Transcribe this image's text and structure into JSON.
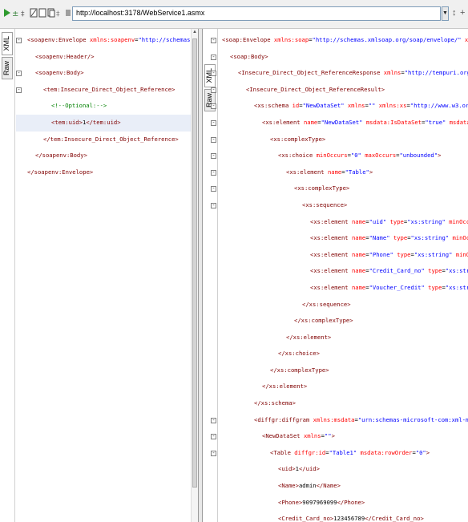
{
  "toolbar": {
    "url": "http://localhost:3178/WebService1.asmx",
    "dropdown_glyph": "▼",
    "icons": [
      "run-icon",
      "add-header-icon",
      "format-icon",
      "settings-icon",
      "clear-icon",
      "copy-icon",
      "split-icon",
      "stop-icon"
    ],
    "right_glyphs": [
      "↕",
      "+"
    ]
  },
  "left_pane": {
    "tabs": [
      "XML",
      "Raw"
    ],
    "lines": [
      {
        "indent": 0,
        "fold": "-",
        "parts": [
          {
            "t": "tag",
            "v": "<soapenv:Envelope "
          },
          {
            "t": "attr",
            "v": "xmlns:soapenv"
          },
          {
            "t": "txt",
            "v": "="
          },
          {
            "t": "val",
            "v": "\"http://schemas.xmlsoap.org/soap/"
          }
        ]
      },
      {
        "indent": 1,
        "fold": "",
        "parts": [
          {
            "t": "tag",
            "v": "<soapenv:Header/>"
          }
        ]
      },
      {
        "indent": 1,
        "fold": "-",
        "parts": [
          {
            "t": "tag",
            "v": "<soapenv:Body>"
          }
        ]
      },
      {
        "indent": 2,
        "fold": "-",
        "parts": [
          {
            "t": "tag",
            "v": "<tem:Insecure_Direct_Object_Reference>"
          }
        ]
      },
      {
        "indent": 3,
        "fold": "",
        "parts": [
          {
            "t": "cmt",
            "v": "<!--Optional:-->"
          }
        ]
      },
      {
        "indent": 3,
        "fold": "",
        "hl": true,
        "parts": [
          {
            "t": "tag",
            "v": "<tem:uid>"
          },
          {
            "t": "txt",
            "v": "1"
          },
          {
            "t": "tag",
            "v": "</tem:uid>"
          }
        ]
      },
      {
        "indent": 2,
        "fold": "",
        "parts": [
          {
            "t": "tag",
            "v": "</tem:Insecure_Direct_Object_Reference>"
          }
        ]
      },
      {
        "indent": 1,
        "fold": "",
        "parts": [
          {
            "t": "tag",
            "v": "</soapenv:Body>"
          }
        ]
      },
      {
        "indent": 0,
        "fold": "",
        "parts": [
          {
            "t": "tag",
            "v": "</soapenv:Envelope>"
          }
        ]
      }
    ]
  },
  "right_pane": {
    "tabs": [
      "XML",
      "Raw"
    ],
    "lines": [
      {
        "indent": 0,
        "fold": "-",
        "parts": [
          {
            "t": "tag",
            "v": "<soap:Envelope "
          },
          {
            "t": "attr",
            "v": "xmlns:soap"
          },
          {
            "t": "txt",
            "v": "="
          },
          {
            "t": "val",
            "v": "\"http://schemas.xmlsoap.org/soap/envelope/\""
          },
          {
            "t": "attr",
            "v": " xmlns:xsi"
          },
          {
            "t": "txt",
            "v": "="
          },
          {
            "t": "val",
            "v": "\"http://www.w3.or"
          }
        ]
      },
      {
        "indent": 1,
        "fold": "-",
        "parts": [
          {
            "t": "tag",
            "v": "<soap:Body>"
          }
        ]
      },
      {
        "indent": 2,
        "fold": "-",
        "parts": [
          {
            "t": "tag",
            "v": "<Insecure_Direct_Object_ReferenceResponse "
          },
          {
            "t": "attr",
            "v": "xmlns"
          },
          {
            "t": "txt",
            "v": "="
          },
          {
            "t": "val",
            "v": "\"http://tempuri.org/\""
          },
          {
            "t": "tag",
            "v": ">"
          }
        ]
      },
      {
        "indent": 3,
        "fold": "-",
        "parts": [
          {
            "t": "tag",
            "v": "<Insecure_Direct_Object_ReferenceResult>"
          }
        ]
      },
      {
        "indent": 4,
        "fold": "-",
        "parts": [
          {
            "t": "tag",
            "v": "<xs:schema "
          },
          {
            "t": "attr",
            "v": "id"
          },
          {
            "t": "txt",
            "v": "="
          },
          {
            "t": "val",
            "v": "\"NewDataSet\""
          },
          {
            "t": "attr",
            "v": " xmlns"
          },
          {
            "t": "txt",
            "v": "="
          },
          {
            "t": "val",
            "v": "\"\""
          },
          {
            "t": "attr",
            "v": " xmlns:xs"
          },
          {
            "t": "txt",
            "v": "="
          },
          {
            "t": "val",
            "v": "\"http://www.w3.org/2001/XMLSchema\""
          },
          {
            "t": "attr",
            "v": " xmlns"
          }
        ]
      },
      {
        "indent": 5,
        "fold": "-",
        "parts": [
          {
            "t": "tag",
            "v": "<xs:element "
          },
          {
            "t": "attr",
            "v": "name"
          },
          {
            "t": "txt",
            "v": "="
          },
          {
            "t": "val",
            "v": "\"NewDataSet\""
          },
          {
            "t": "attr",
            "v": " msdata:IsDataSet"
          },
          {
            "t": "txt",
            "v": "="
          },
          {
            "t": "val",
            "v": "\"true\""
          },
          {
            "t": "attr",
            "v": " msdata:UseCurrentLocale"
          },
          {
            "t": "txt",
            "v": "="
          },
          {
            "t": "val",
            "v": "\"t"
          }
        ]
      },
      {
        "indent": 6,
        "fold": "-",
        "parts": [
          {
            "t": "tag",
            "v": "<xs:complexType>"
          }
        ]
      },
      {
        "indent": 7,
        "fold": "-",
        "parts": [
          {
            "t": "tag",
            "v": "<xs:choice "
          },
          {
            "t": "attr",
            "v": "minOccurs"
          },
          {
            "t": "txt",
            "v": "="
          },
          {
            "t": "val",
            "v": "\"0\""
          },
          {
            "t": "attr",
            "v": " maxOccurs"
          },
          {
            "t": "txt",
            "v": "="
          },
          {
            "t": "val",
            "v": "\"unbounded\""
          },
          {
            "t": "tag",
            "v": ">"
          }
        ]
      },
      {
        "indent": 8,
        "fold": "-",
        "parts": [
          {
            "t": "tag",
            "v": "<xs:element "
          },
          {
            "t": "attr",
            "v": "name"
          },
          {
            "t": "txt",
            "v": "="
          },
          {
            "t": "val",
            "v": "\"Table\""
          },
          {
            "t": "tag",
            "v": ">"
          }
        ]
      },
      {
        "indent": 9,
        "fold": "-",
        "parts": [
          {
            "t": "tag",
            "v": "<xs:complexType>"
          }
        ]
      },
      {
        "indent": 10,
        "fold": "-",
        "parts": [
          {
            "t": "tag",
            "v": "<xs:sequence>"
          }
        ]
      },
      {
        "indent": 11,
        "fold": "",
        "parts": [
          {
            "t": "tag",
            "v": "<xs:element "
          },
          {
            "t": "attr",
            "v": "name"
          },
          {
            "t": "txt",
            "v": "="
          },
          {
            "t": "val",
            "v": "\"uid\""
          },
          {
            "t": "attr",
            "v": " type"
          },
          {
            "t": "txt",
            "v": "="
          },
          {
            "t": "val",
            "v": "\"xs:string\""
          },
          {
            "t": "attr",
            "v": " minOccurs"
          },
          {
            "t": "txt",
            "v": "="
          },
          {
            "t": "val",
            "v": "\"0\""
          },
          {
            "t": "tag",
            "v": "/>"
          }
        ]
      },
      {
        "indent": 11,
        "fold": "",
        "parts": [
          {
            "t": "tag",
            "v": "<xs:element "
          },
          {
            "t": "attr",
            "v": "name"
          },
          {
            "t": "txt",
            "v": "="
          },
          {
            "t": "val",
            "v": "\"Name\""
          },
          {
            "t": "attr",
            "v": " type"
          },
          {
            "t": "txt",
            "v": "="
          },
          {
            "t": "val",
            "v": "\"xs:string\""
          },
          {
            "t": "attr",
            "v": " minOccurs"
          },
          {
            "t": "txt",
            "v": "="
          },
          {
            "t": "val",
            "v": "\"0\""
          },
          {
            "t": "tag",
            "v": "/>"
          }
        ]
      },
      {
        "indent": 11,
        "fold": "",
        "parts": [
          {
            "t": "tag",
            "v": "<xs:element "
          },
          {
            "t": "attr",
            "v": "name"
          },
          {
            "t": "txt",
            "v": "="
          },
          {
            "t": "val",
            "v": "\"Phone\""
          },
          {
            "t": "attr",
            "v": " type"
          },
          {
            "t": "txt",
            "v": "="
          },
          {
            "t": "val",
            "v": "\"xs:string\""
          },
          {
            "t": "attr",
            "v": " minOccurs"
          },
          {
            "t": "txt",
            "v": "="
          },
          {
            "t": "val",
            "v": "\"0\""
          },
          {
            "t": "tag",
            "v": "/>"
          }
        ]
      },
      {
        "indent": 11,
        "fold": "",
        "parts": [
          {
            "t": "tag",
            "v": "<xs:element "
          },
          {
            "t": "attr",
            "v": "name"
          },
          {
            "t": "txt",
            "v": "="
          },
          {
            "t": "val",
            "v": "\"Credit_Card_no\""
          },
          {
            "t": "attr",
            "v": " type"
          },
          {
            "t": "txt",
            "v": "="
          },
          {
            "t": "val",
            "v": "\"xs:string\""
          },
          {
            "t": "attr",
            "v": " minOccurs"
          },
          {
            "t": "txt",
            "v": "="
          },
          {
            "t": "val",
            "v": "\""
          }
        ]
      },
      {
        "indent": 11,
        "fold": "",
        "parts": [
          {
            "t": "tag",
            "v": "<xs:element "
          },
          {
            "t": "attr",
            "v": "name"
          },
          {
            "t": "txt",
            "v": "="
          },
          {
            "t": "val",
            "v": "\"Voucher_Credit\""
          },
          {
            "t": "attr",
            "v": " type"
          },
          {
            "t": "txt",
            "v": "="
          },
          {
            "t": "val",
            "v": "\"xs:string\""
          },
          {
            "t": "attr",
            "v": " minOccurs"
          },
          {
            "t": "txt",
            "v": "="
          },
          {
            "t": "val",
            "v": "\""
          }
        ]
      },
      {
        "indent": 10,
        "fold": "",
        "parts": [
          {
            "t": "tag",
            "v": "</xs:sequence>"
          }
        ]
      },
      {
        "indent": 9,
        "fold": "",
        "parts": [
          {
            "t": "tag",
            "v": "</xs:complexType>"
          }
        ]
      },
      {
        "indent": 8,
        "fold": "",
        "parts": [
          {
            "t": "tag",
            "v": "</xs:element>"
          }
        ]
      },
      {
        "indent": 7,
        "fold": "",
        "parts": [
          {
            "t": "tag",
            "v": "</xs:choice>"
          }
        ]
      },
      {
        "indent": 6,
        "fold": "",
        "parts": [
          {
            "t": "tag",
            "v": "</xs:complexType>"
          }
        ]
      },
      {
        "indent": 5,
        "fold": "",
        "parts": [
          {
            "t": "tag",
            "v": "</xs:element>"
          }
        ]
      },
      {
        "indent": 4,
        "fold": "",
        "parts": [
          {
            "t": "tag",
            "v": "</xs:schema>"
          }
        ]
      },
      {
        "indent": 4,
        "fold": "-",
        "parts": [
          {
            "t": "tag",
            "v": "<diffgr:diffgram "
          },
          {
            "t": "attr",
            "v": "xmlns:msdata"
          },
          {
            "t": "txt",
            "v": "="
          },
          {
            "t": "val",
            "v": "\"urn:schemas-microsoft-com:xml-msdata\""
          },
          {
            "t": "attr",
            "v": " xmlns:diffgr"
          },
          {
            "t": "txt",
            "v": "="
          },
          {
            "t": "val",
            "v": "\""
          }
        ]
      },
      {
        "indent": 5,
        "fold": "-",
        "parts": [
          {
            "t": "tag",
            "v": "<NewDataSet "
          },
          {
            "t": "attr",
            "v": "xmlns"
          },
          {
            "t": "txt",
            "v": "="
          },
          {
            "t": "val",
            "v": "\"\""
          },
          {
            "t": "tag",
            "v": ">"
          }
        ]
      },
      {
        "indent": 6,
        "fold": "-",
        "parts": [
          {
            "t": "tag",
            "v": "<Table "
          },
          {
            "t": "attr",
            "v": "diffgr:id"
          },
          {
            "t": "txt",
            "v": "="
          },
          {
            "t": "val",
            "v": "\"Table1\""
          },
          {
            "t": "attr",
            "v": " msdata:rowOrder"
          },
          {
            "t": "txt",
            "v": "="
          },
          {
            "t": "val",
            "v": "\"0\""
          },
          {
            "t": "tag",
            "v": ">"
          }
        ]
      },
      {
        "indent": 7,
        "fold": "",
        "parts": [
          {
            "t": "tag",
            "v": "<uid>"
          },
          {
            "t": "txt",
            "v": "1"
          },
          {
            "t": "tag",
            "v": "</uid>"
          }
        ]
      },
      {
        "indent": 7,
        "fold": "",
        "parts": [
          {
            "t": "tag",
            "v": "<Name>"
          },
          {
            "t": "txt",
            "v": "admin"
          },
          {
            "t": "tag",
            "v": "</Name>"
          }
        ]
      },
      {
        "indent": 7,
        "fold": "",
        "parts": [
          {
            "t": "tag",
            "v": "<Phone>"
          },
          {
            "t": "txt",
            "v": "9097969099"
          },
          {
            "t": "tag",
            "v": "</Phone>"
          }
        ]
      },
      {
        "indent": 7,
        "fold": "",
        "parts": [
          {
            "t": "tag",
            "v": "<Credit_Card_no>"
          },
          {
            "t": "txt",
            "v": "123456789"
          },
          {
            "t": "tag",
            "v": "</Credit_Card_no>"
          }
        ]
      }
    ]
  }
}
